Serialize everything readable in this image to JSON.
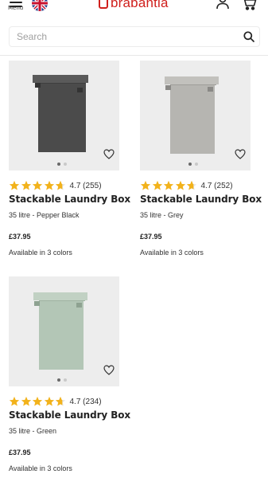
{
  "header": {
    "menu_label": "Menu",
    "logo_text": "brabantia",
    "brand_color": "#d0201d",
    "icons": [
      "menu-icon",
      "uk-flag-icon",
      "account-icon",
      "cart-icon"
    ]
  },
  "search": {
    "placeholder": "Search",
    "icon": "search-icon"
  },
  "products": [
    {
      "rating": 4.7,
      "rating_text": "4.7 (255)",
      "title": "Stackable Laundry Box",
      "subtitle": "35 litre - Pepper Black",
      "price": "£37.95",
      "availability": "Available in 3 colors",
      "color": "#4b4b4b"
    },
    {
      "rating": 4.7,
      "rating_text": "4.7 (252)",
      "title": "Stackable Laundry Box",
      "subtitle": "35 litre - Grey",
      "price": "£37.95",
      "availability": "Available in 3 colors",
      "color": "#b6b5b1"
    },
    {
      "rating": 4.7,
      "rating_text": "4.7 (234)",
      "title": "Stackable Laundry Box",
      "subtitle": "35 litre - Green",
      "price": "£37.95",
      "availability": "Available in 3 colors",
      "color": "#b3c6b6"
    }
  ],
  "star_color": "#f2b21b"
}
